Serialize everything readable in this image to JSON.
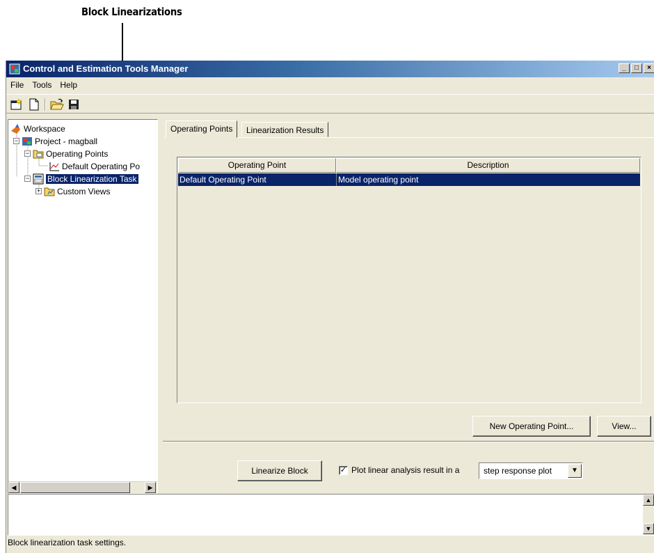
{
  "callout": {
    "label": "Block Linearizations"
  },
  "window": {
    "title": "Control and Estimation Tools Manager",
    "controls": {
      "minimize": "_",
      "maximize": "□",
      "close": "×"
    }
  },
  "menu": [
    "File",
    "Tools",
    "Help"
  ],
  "toolbar": {
    "icons": [
      "new-project-icon",
      "new-task-icon",
      "open-folder-icon",
      "save-icon"
    ]
  },
  "tree": {
    "workspace": "Workspace",
    "project": "Project - magball",
    "operating_points": "Operating Points",
    "default_operating_point": "Default Operating Po",
    "block_linearization_task": "Block Linearization Task",
    "custom_views": "Custom Views"
  },
  "tabs": [
    "Operating Points",
    "Linearization Results"
  ],
  "table": {
    "headers": [
      "Operating Point",
      "Description"
    ],
    "rows": [
      {
        "operating_point": "Default Operating Point",
        "description": "Model operating point"
      }
    ]
  },
  "buttons": {
    "new_operating_point": "New Operating Point...",
    "view": "View...",
    "linearize_block": "Linearize Block"
  },
  "plot_option": {
    "checkbox_label": "Plot linear analysis result in a",
    "checked": true,
    "plot_type": "step response plot"
  },
  "status_bar": "Block linearization task settings.",
  "colors": {
    "selection": "#0a246a",
    "panel": "#ece9d8",
    "title_start": "#0a246a"
  }
}
